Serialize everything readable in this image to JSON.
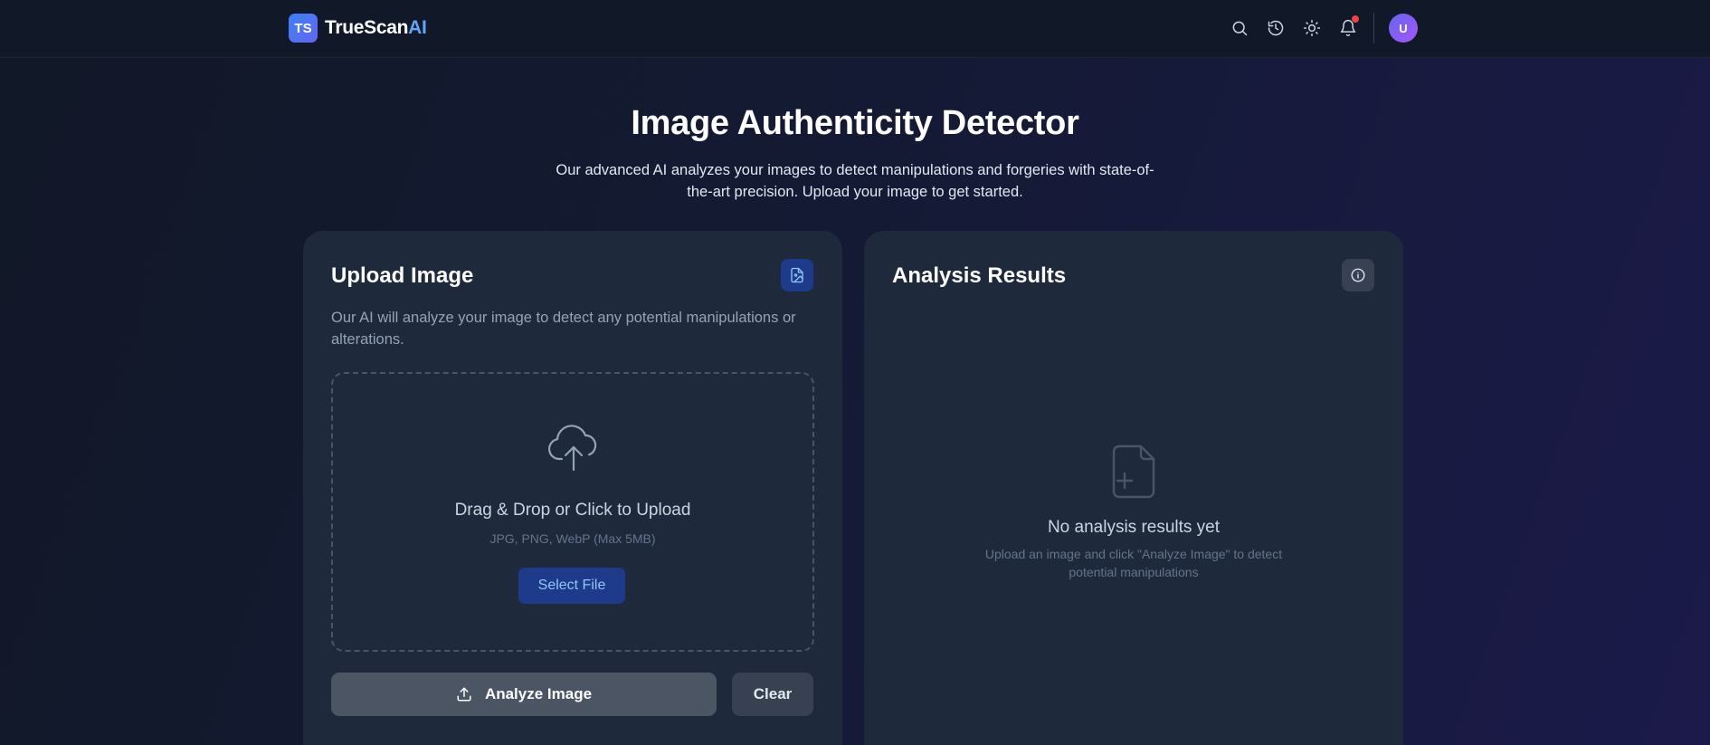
{
  "header": {
    "logo_badge": "TS",
    "logo_main": "TrueScan",
    "logo_accent": "AI",
    "icons": [
      "search-icon",
      "history-icon",
      "theme-toggle-icon",
      "bell-icon"
    ],
    "avatar_initial": "U"
  },
  "hero": {
    "title": "Image Authenticity Detector",
    "subtitle": "Our advanced AI analyzes your images to detect manipulations and forgeries with state-of-the-art precision. Upload your image to get started."
  },
  "upload": {
    "title": "Upload Image",
    "description": "Our AI will analyze your image to detect any potential manipulations or alterations.",
    "dropzone_title": "Drag & Drop or Click to Upload",
    "dropzone_formats": "JPG, PNG, WebP (Max 5MB)",
    "select_label": "Select File",
    "analyze_label": "Analyze Image",
    "clear_label": "Clear"
  },
  "results": {
    "title": "Analysis Results",
    "empty_title": "No analysis results yet",
    "empty_sub": "Upload an image and click \"Analyze Image\" to detect potential manipulations"
  },
  "colors": {
    "accent": "#3b82f6",
    "accent_light": "#60a5fa",
    "card_bg": "#1e293b",
    "notification_dot": "#ef4444"
  }
}
